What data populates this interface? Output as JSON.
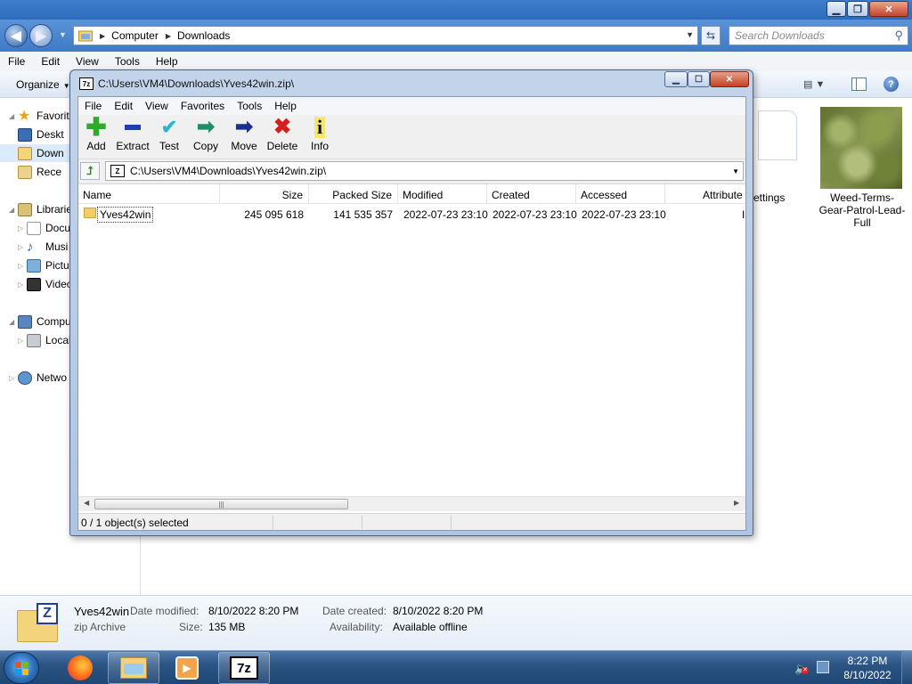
{
  "explorer": {
    "breadcrumb": [
      "Computer",
      "Downloads"
    ],
    "search_placeholder": "Search Downloads",
    "menu": [
      "File",
      "Edit",
      "View",
      "Tools",
      "Help"
    ],
    "organize_label": "Organize",
    "nav_pane": {
      "favorites": "Favorit",
      "desktop": "Deskt",
      "downloads": "Down",
      "recent": "Rece",
      "libraries": "Librarie",
      "documents": "Docu",
      "music": "Musi",
      "pictures": "Pictu",
      "videos": "Video",
      "computer": "Compu",
      "local_disk": "Local",
      "network": "Netwo"
    },
    "files": {
      "settings_label": "ettings",
      "weed_label": "Weed-Terms-Gear-Patrol-Lead-Full"
    },
    "details": {
      "name": "Yves42win",
      "type": "zip Archive",
      "date_modified_label": "Date modified:",
      "date_modified": "8/10/2022 8:20 PM",
      "size_label": "Size:",
      "size": "135 MB",
      "date_created_label": "Date created:",
      "date_created": "8/10/2022 8:20 PM",
      "availability_label": "Availability:",
      "availability": "Available offline"
    }
  },
  "zipwin": {
    "title": "C:\\Users\\VM4\\Downloads\\Yves42win.zip\\",
    "icon_text": "7z",
    "menu": [
      "File",
      "Edit",
      "View",
      "Favorites",
      "Tools",
      "Help"
    ],
    "toolbar": {
      "add": "Add",
      "extract": "Extract",
      "test": "Test",
      "copy": "Copy",
      "move": "Move",
      "delete": "Delete",
      "info": "Info"
    },
    "path": "C:\\Users\\VM4\\Downloads\\Yves42win.zip\\",
    "columns": {
      "name": "Name",
      "size": "Size",
      "packed_size": "Packed Size",
      "modified": "Modified",
      "created": "Created",
      "accessed": "Accessed",
      "attributes": "Attribute"
    },
    "rows": [
      {
        "name": "Yves42win",
        "size": "245 095 618",
        "packed_size": "141 535 357",
        "modified": "2022-07-23 23:10",
        "created": "2022-07-23 23:10",
        "accessed": "2022-07-23 23:10",
        "attributes": "I"
      }
    ],
    "status": "0 / 1 object(s) selected"
  },
  "taskbar": {
    "time": "8:22 PM",
    "date": "8/10/2022",
    "sevenzip_icon_text": "7z"
  }
}
